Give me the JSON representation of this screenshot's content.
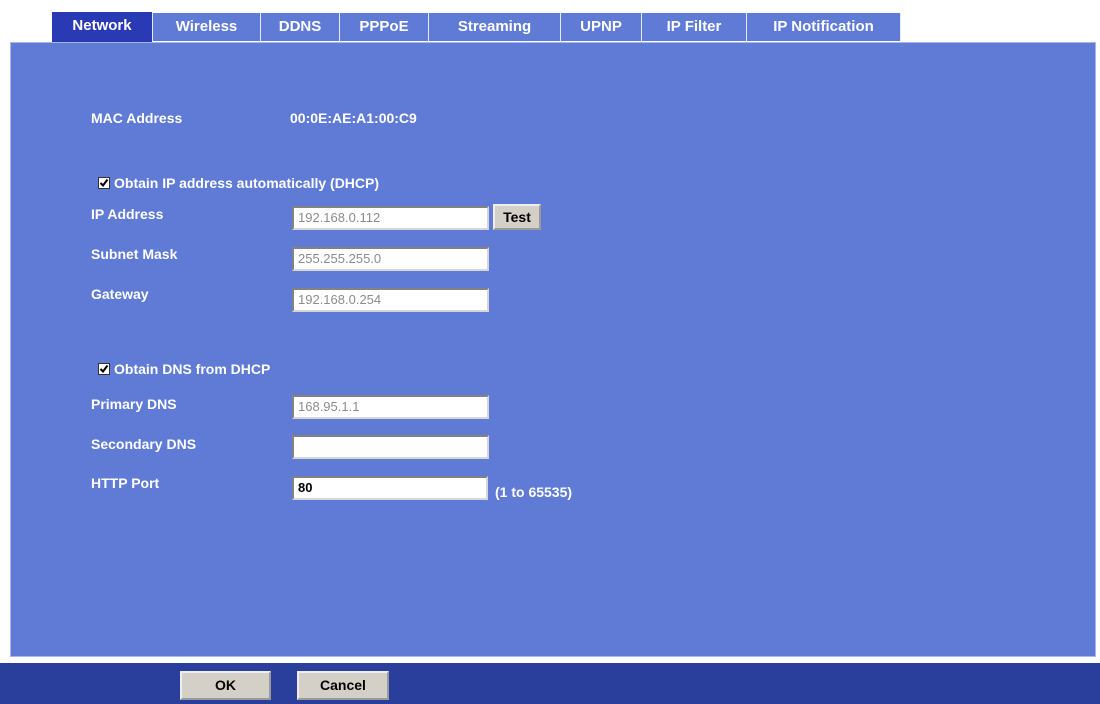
{
  "tabs": [
    {
      "label": "Network",
      "active": true
    },
    {
      "label": "Wireless",
      "active": false
    },
    {
      "label": "DDNS",
      "active": false
    },
    {
      "label": "PPPoE",
      "active": false
    },
    {
      "label": "Streaming",
      "active": false
    },
    {
      "label": "UPNP",
      "active": false
    },
    {
      "label": "IP Filter",
      "active": false
    },
    {
      "label": "IP Notification",
      "active": false
    }
  ],
  "network": {
    "mac_label": "MAC Address",
    "mac_value": "00:0E:AE:A1:00:C9",
    "dhcp_label": "Obtain IP address automatically (DHCP)",
    "dhcp_checked": true,
    "ip_label": "IP Address",
    "ip_value": "192.168.0.112",
    "test_label": "Test",
    "subnet_label": "Subnet Mask",
    "subnet_value": "255.255.255.0",
    "gateway_label": "Gateway",
    "gateway_value": "192.168.0.254",
    "dns_dhcp_label": "Obtain DNS from DHCP",
    "dns_dhcp_checked": true,
    "primary_dns_label": "Primary DNS",
    "primary_dns_value": "168.95.1.1",
    "secondary_dns_label": "Secondary DNS",
    "secondary_dns_value": "",
    "http_port_label": "HTTP Port",
    "http_port_value": "80",
    "http_port_hint": "(1 to 65535)"
  },
  "footer": {
    "ok_label": "OK",
    "cancel_label": "Cancel"
  },
  "colors": {
    "panel": "#5f7bd6",
    "active_tab": "#2a39b4",
    "bottom_bar": "#2a3f9c"
  }
}
